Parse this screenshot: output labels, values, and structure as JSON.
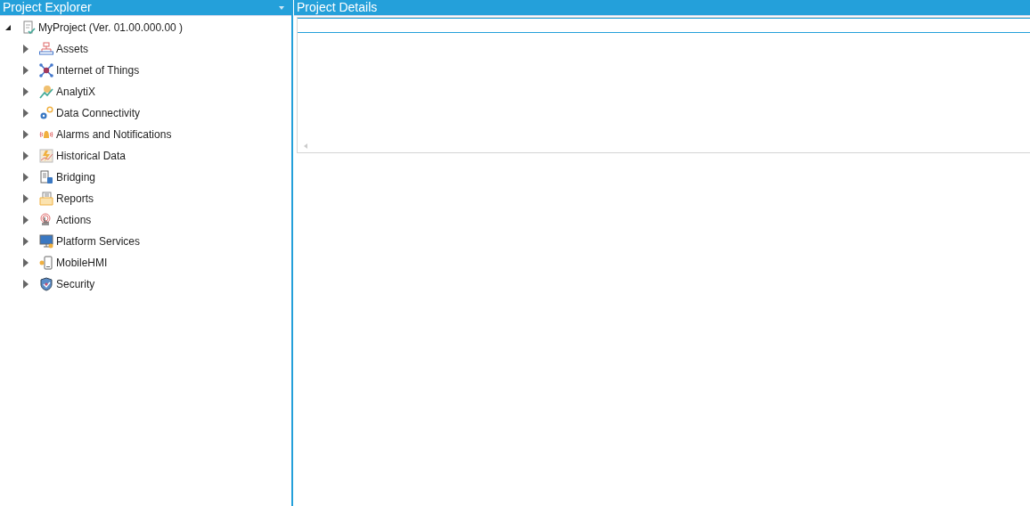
{
  "explorer": {
    "title": "Project Explorer",
    "tree": [
      {
        "label": "MyProject (Ver. 01.00.000.00 )",
        "expanded": true,
        "children": [
          {
            "label": "Assets",
            "expanded": false
          },
          {
            "label": "Internet of Things",
            "expanded": false
          },
          {
            "label": "AnalytiX",
            "expanded": false
          },
          {
            "label": "Data Connectivity",
            "expanded": false
          },
          {
            "label": "Alarms and Notifications",
            "expanded": false
          },
          {
            "label": "Historical Data",
            "expanded": false
          },
          {
            "label": "Bridging",
            "expanded": false
          },
          {
            "label": "Reports",
            "expanded": false
          },
          {
            "label": "Actions",
            "expanded": false
          },
          {
            "label": "Platform Services",
            "expanded": false
          },
          {
            "label": "MobileHMI",
            "expanded": false
          },
          {
            "label": "Security",
            "expanded": false
          }
        ]
      }
    ]
  },
  "details": {
    "title": "Project Details"
  }
}
